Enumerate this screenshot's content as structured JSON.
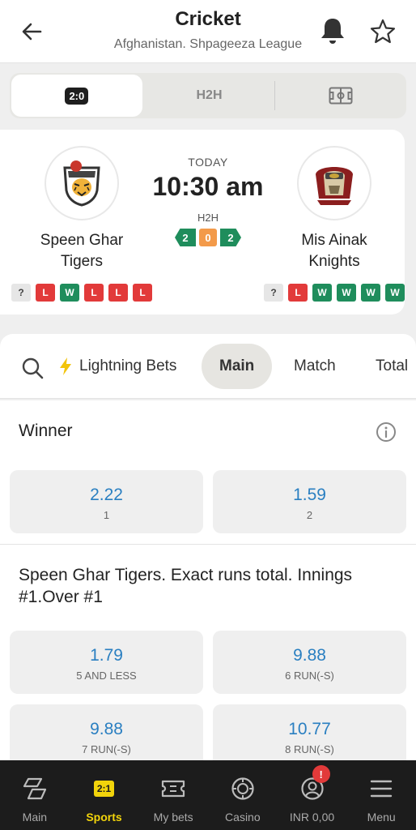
{
  "header": {
    "title": "Cricket",
    "subtitle": "Afghanistan. Shpageeza League"
  },
  "view_tabs": {
    "score_label": "2:0",
    "h2h_label": "H2H"
  },
  "match": {
    "day_label": "TODAY",
    "time": "10:30 am",
    "h2h_label": "H2H",
    "h2h_scores": [
      "2",
      "0",
      "2"
    ],
    "team_left": {
      "name_line1": "Speen Ghar",
      "name_line2": "Tigers",
      "form": [
        "?",
        "L",
        "W",
        "L",
        "L",
        "L"
      ]
    },
    "team_right": {
      "name_line1": "Mis Ainak",
      "name_line2": "Knights",
      "form": [
        "?",
        "L",
        "W",
        "W",
        "W",
        "W"
      ]
    }
  },
  "bet_tabs": {
    "lightning": "Lightning Bets",
    "main": "Main",
    "match": "Match",
    "total": "Total"
  },
  "markets": {
    "winner": {
      "title": "Winner",
      "odds": [
        {
          "value": "2.22",
          "label": "1"
        },
        {
          "value": "1.59",
          "label": "2"
        }
      ]
    },
    "exact_runs": {
      "title_line1": "Speen Ghar Tigers. Exact runs total. Innings",
      "title_line2": "#1.Over #1",
      "odds": [
        {
          "value": "1.79",
          "label": "5 AND LESS"
        },
        {
          "value": "9.88",
          "label": "6 RUN(-S)"
        },
        {
          "value": "9.88",
          "label": "7 RUN(-S)"
        },
        {
          "value": "10.77",
          "label": "8 RUN(-S)"
        }
      ]
    }
  },
  "bottom_nav": {
    "main": "Main",
    "sports": "Sports",
    "sports_chip": "2:1",
    "my_bets": "My bets",
    "casino": "Casino",
    "account": "INR 0,00",
    "account_badge": "!",
    "menu": "Menu"
  },
  "colors": {
    "accent": "#f2d40b",
    "odd_value": "#2a7fc1",
    "win": "#1f8d5c",
    "loss": "#e23a3a",
    "draw": "#f39a4a"
  }
}
